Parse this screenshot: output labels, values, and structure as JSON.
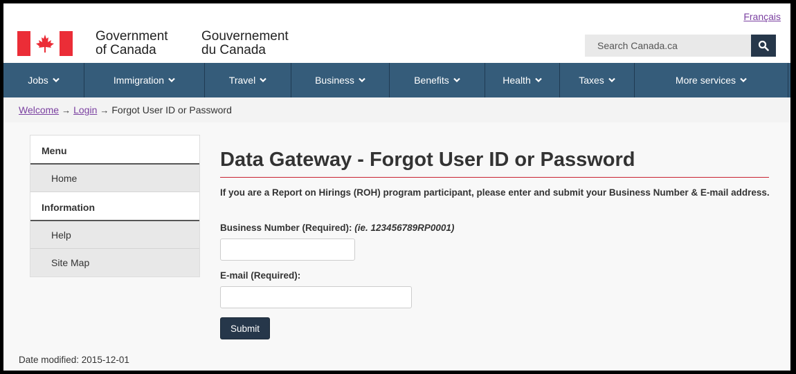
{
  "header": {
    "language_link": "Français",
    "signature_en": [
      "Government",
      "of Canada"
    ],
    "signature_fr": [
      "Gouvernement",
      "du Canada"
    ],
    "search_placeholder": "Search Canada.ca"
  },
  "nav": {
    "items": [
      {
        "label": "Jobs"
      },
      {
        "label": "Immigration"
      },
      {
        "label": "Travel"
      },
      {
        "label": "Business"
      },
      {
        "label": "Benefits"
      },
      {
        "label": "Health"
      },
      {
        "label": "Taxes"
      },
      {
        "label": "More services"
      }
    ]
  },
  "breadcrumb": {
    "items": [
      "Welcome",
      "Login",
      "Forgot User ID or Password"
    ],
    "separator": "→"
  },
  "sidebar": {
    "menu_heading": "Menu",
    "home": "Home",
    "info_heading": "Information",
    "help": "Help",
    "site_map": "Site Map"
  },
  "content": {
    "title": "Data Gateway - Forgot User ID or Password",
    "intro": "If you are a Report on Hirings (ROH) program participant, please enter and submit your Business Number & E-mail address.",
    "business_label": "Business Number (Required): ",
    "business_example": "(ie. 123456789RP0001)",
    "business_value": "",
    "email_label": "E-mail (Required):",
    "email_value": "",
    "submit_label": "Submit"
  },
  "footer": {
    "date_modified": "Date modified: 2015-12-01"
  },
  "colors": {
    "nav_bg": "#355c7a",
    "dark_button": "#26374a",
    "flag_red": "#eb2d37",
    "title_rule": "#c8202f",
    "link": "#7a3fa0"
  },
  "icons": {
    "search": "search-icon",
    "nav_chevron": "chevron-down-icon",
    "flag": "maple-leaf-icon"
  }
}
